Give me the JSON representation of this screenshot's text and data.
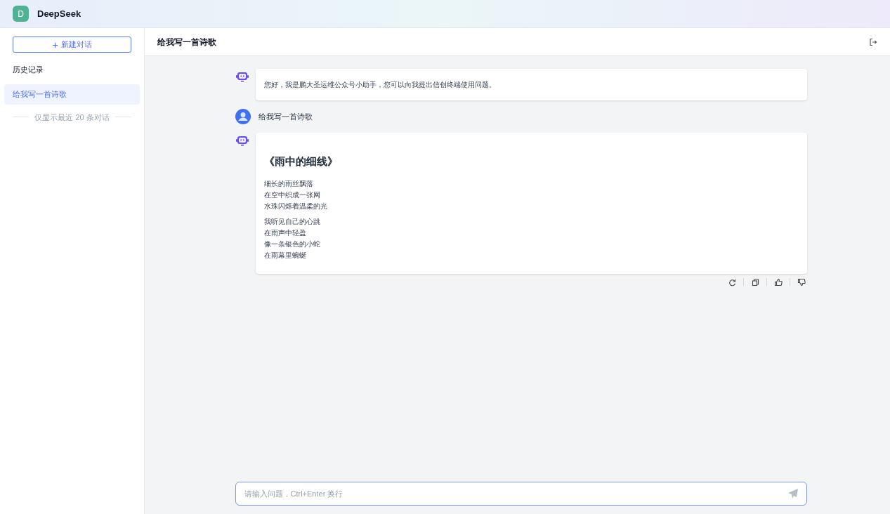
{
  "app": {
    "logo_letter": "D",
    "name": "DeepSeek"
  },
  "sidebar": {
    "new_chat_button": {
      "icon": "+",
      "label": "新建对话"
    },
    "history_title": "历史记录",
    "items": [
      {
        "label": "给我写一首诗歌",
        "selected": true
      }
    ],
    "footer_note": "仅显示最近 20 条对话"
  },
  "chat": {
    "title": "给我写一首诗歌",
    "messages": [
      {
        "kind": "assistant",
        "text": "您好，我是鹏大圣运维公众号小助手，您可以向我提出信创终端使用问题。"
      },
      {
        "kind": "user",
        "text": "给我写一首诗歌"
      },
      {
        "kind": "poem",
        "title": "《雨中的细线》",
        "stanzas": [
          [
            "细长的雨丝飘落",
            "在空中织成一张网",
            "水珠闪烁着温柔的光"
          ],
          [
            "我听见自己的心跳",
            "在雨声中轻盈",
            "像一条银色的小蛇",
            "在雨幕里蜿蜒"
          ]
        ]
      }
    ],
    "input": {
      "placeholder": "请输入问题，Ctrl+Enter 换行"
    }
  }
}
